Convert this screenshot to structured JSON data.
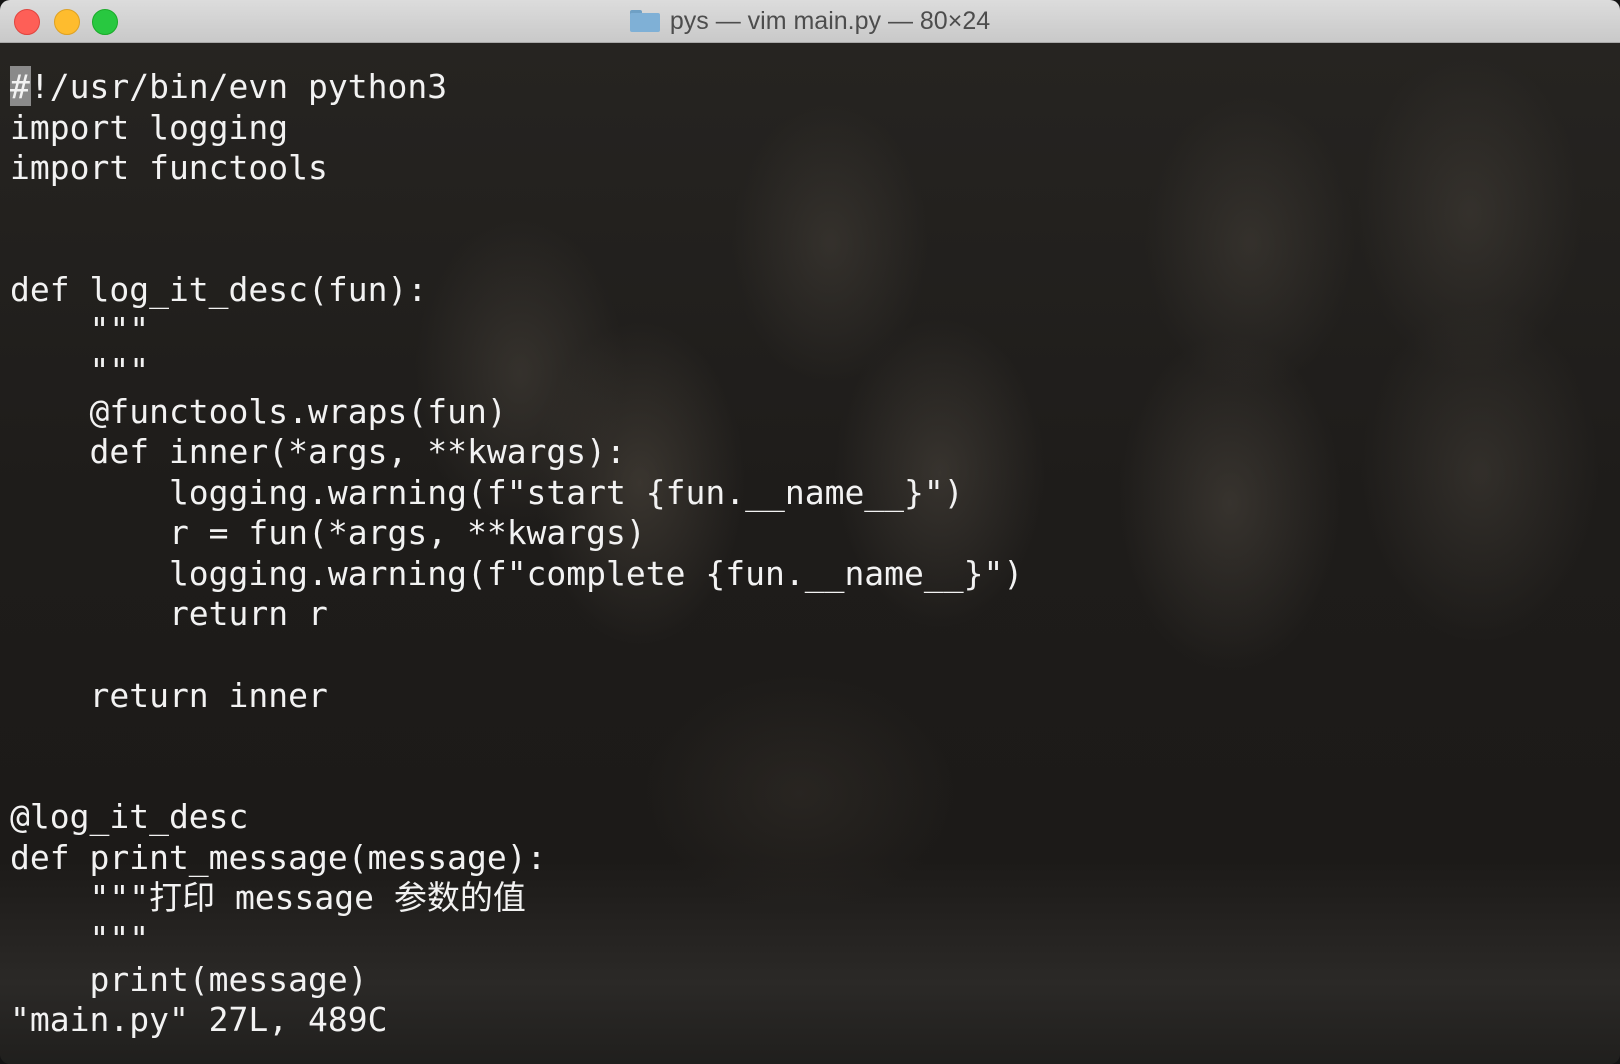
{
  "window": {
    "title": "pys — vim main.py — 80×24"
  },
  "editor": {
    "lines": [
      "#!/usr/bin/evn python3",
      "import logging",
      "import functools",
      "",
      "",
      "def log_it_desc(fun):",
      "    \"\"\"",
      "    \"\"\"",
      "    @functools.wraps(fun)",
      "    def inner(*args, **kwargs):",
      "        logging.warning(f\"start {fun.__name__}\")",
      "        r = fun(*args, **kwargs)",
      "        logging.warning(f\"complete {fun.__name__}\")",
      "        return r",
      "",
      "    return inner",
      "",
      "",
      "@log_it_desc",
      "def print_message(message):",
      "    \"\"\"打印 message 参数的值",
      "    \"\"\"",
      "    print(message)"
    ],
    "status_line": "\"main.py\" 27L, 489C"
  }
}
